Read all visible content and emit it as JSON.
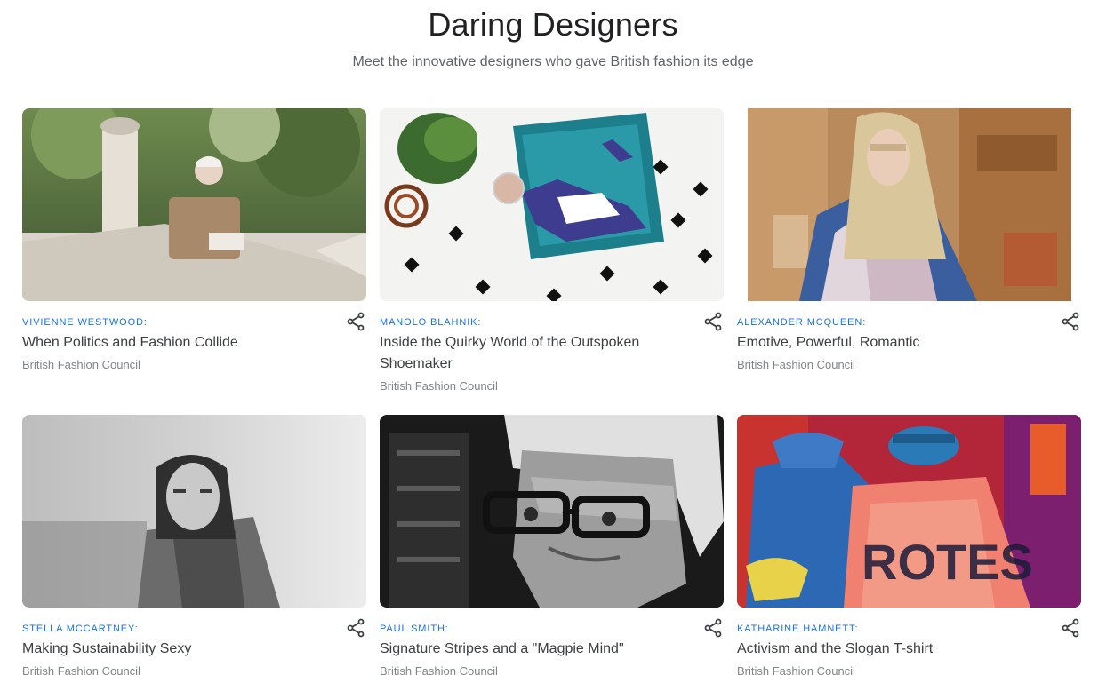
{
  "header": {
    "title": "Daring Designers",
    "subtitle": "Meet the innovative designers who gave British fashion its edge"
  },
  "cards": [
    {
      "tag": "VIVIENNE WESTWOOD:",
      "title": "When Politics and Fashion Collide",
      "source": "British Fashion Council",
      "share_icon": "share-icon"
    },
    {
      "tag": "MANOLO BLAHNIK:",
      "title": "Inside the Quirky World of the Outspoken Shoemaker",
      "source": "British Fashion Council",
      "share_icon": "share-icon"
    },
    {
      "tag": "ALEXANDER MCQUEEN:",
      "title": "Emotive, Powerful, Romantic",
      "source": "British Fashion Council",
      "share_icon": "share-icon"
    },
    {
      "tag": "STELLA MCCARTNEY:",
      "title": "Making Sustainability Sexy",
      "source": "British Fashion Council",
      "share_icon": "share-icon"
    },
    {
      "tag": "PAUL SMITH:",
      "title": "Signature Stripes and a \"Magpie Mind\"",
      "source": "British Fashion Council",
      "share_icon": "share-icon"
    },
    {
      "tag": "KATHARINE HAMNETT:",
      "title": "Activism and the Slogan T-shirt",
      "source": "British Fashion Council",
      "share_icon": "share-icon"
    }
  ],
  "colors": {
    "accent": "#1a73e8",
    "title_text": "#202124",
    "secondary_text": "#80868b"
  }
}
